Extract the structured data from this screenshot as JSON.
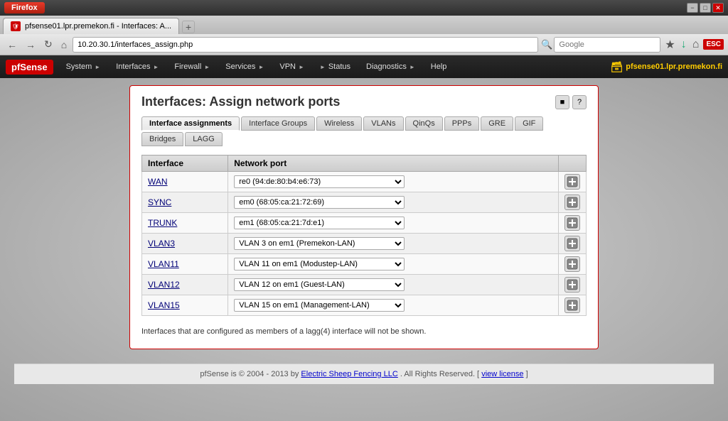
{
  "browser": {
    "firefox_label": "Firefox",
    "tab_title": "pfsense01.lpr.premekon.fi - Interfaces: A...",
    "address": "10.20.30.1/interfaces_assign.php",
    "search_placeholder": "Google",
    "hostname_label": "pfsense01.lpr.premekon.fi"
  },
  "nav": {
    "logo": "pfSense",
    "items": [
      {
        "label": "System"
      },
      {
        "label": "Interfaces"
      },
      {
        "label": "Firewall"
      },
      {
        "label": "Services"
      },
      {
        "label": "VPN"
      },
      {
        "label": "Status"
      },
      {
        "label": "Diagnostics"
      },
      {
        "label": "Help"
      }
    ]
  },
  "page": {
    "title": "Interfaces: Assign network ports",
    "tabs": [
      {
        "label": "Interface assignments",
        "active": true
      },
      {
        "label": "Interface Groups",
        "active": false
      },
      {
        "label": "Wireless",
        "active": false
      },
      {
        "label": "VLANs",
        "active": false
      },
      {
        "label": "QinQs",
        "active": false
      },
      {
        "label": "PPPs",
        "active": false
      },
      {
        "label": "GRE",
        "active": false
      },
      {
        "label": "GIF",
        "active": false
      },
      {
        "label": "Bridges",
        "active": false
      },
      {
        "label": "LAGG",
        "active": false
      }
    ],
    "table": {
      "col1": "Interface",
      "col2": "Network port",
      "rows": [
        {
          "iface": "WAN",
          "port": "re0 (94:de:80:b4:e6:73)"
        },
        {
          "iface": "SYNC",
          "port": "em0 (68:05:ca:21:72:69)"
        },
        {
          "iface": "TRUNK",
          "port": "em1 (68:05:ca:21:7d:e1)"
        },
        {
          "iface": "VLAN3",
          "port": "VLAN 3 on em1 (Premekon-LAN)"
        },
        {
          "iface": "VLAN11",
          "port": "VLAN 11 on em1 (Modustep-LAN)"
        },
        {
          "iface": "VLAN12",
          "port": "VLAN 12 on em1 (Guest-LAN)"
        },
        {
          "iface": "VLAN15",
          "port": "VLAN 15 on em1 (Management-LAN)"
        }
      ]
    },
    "note": "Interfaces that are configured as members of a lagg(4) interface will not be shown."
  },
  "footer": {
    "text_before": "pfSense is © 2004 - 2013 by",
    "link_text": "Electric Sheep Fencing LLC",
    "text_after": ". All Rights Reserved. [",
    "view_license": "view license",
    "close_bracket": "]"
  }
}
